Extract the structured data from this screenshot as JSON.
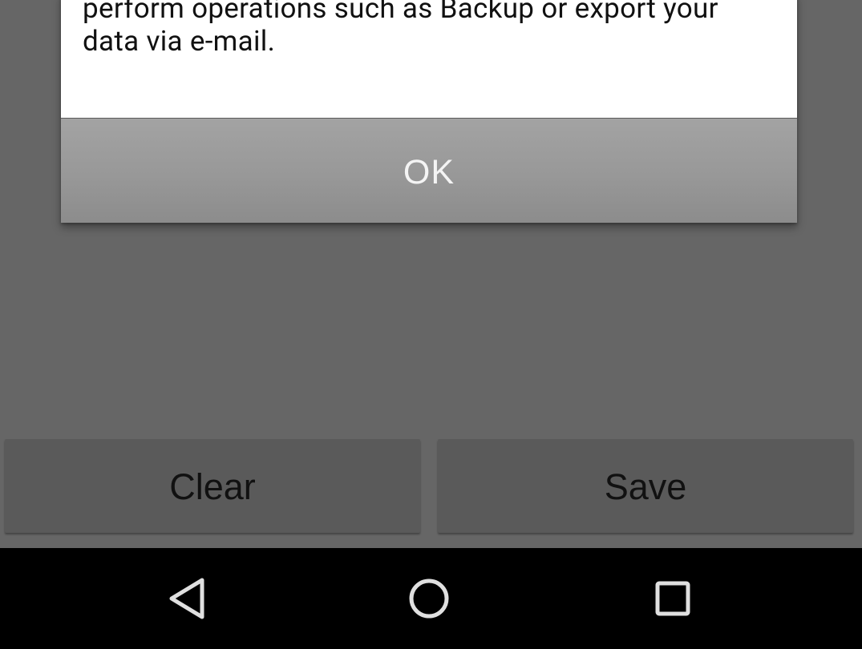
{
  "dialog": {
    "message": "perform operations such as Backup or export your\ndata via e-mail.",
    "ok_label": "OK"
  },
  "actions": {
    "clear_label": "Clear",
    "save_label": "Save"
  },
  "navbar": {
    "back_icon": "triangle-back-icon",
    "home_icon": "circle-home-icon",
    "recents_icon": "square-recents-icon"
  },
  "colors": {
    "dialog_body": "#ffffff",
    "dialog_button": "#989898",
    "scrim": "#666666",
    "action_button": "#5a5a5a",
    "navbar": "#000000",
    "nav_icon": "#e0e0e0"
  }
}
